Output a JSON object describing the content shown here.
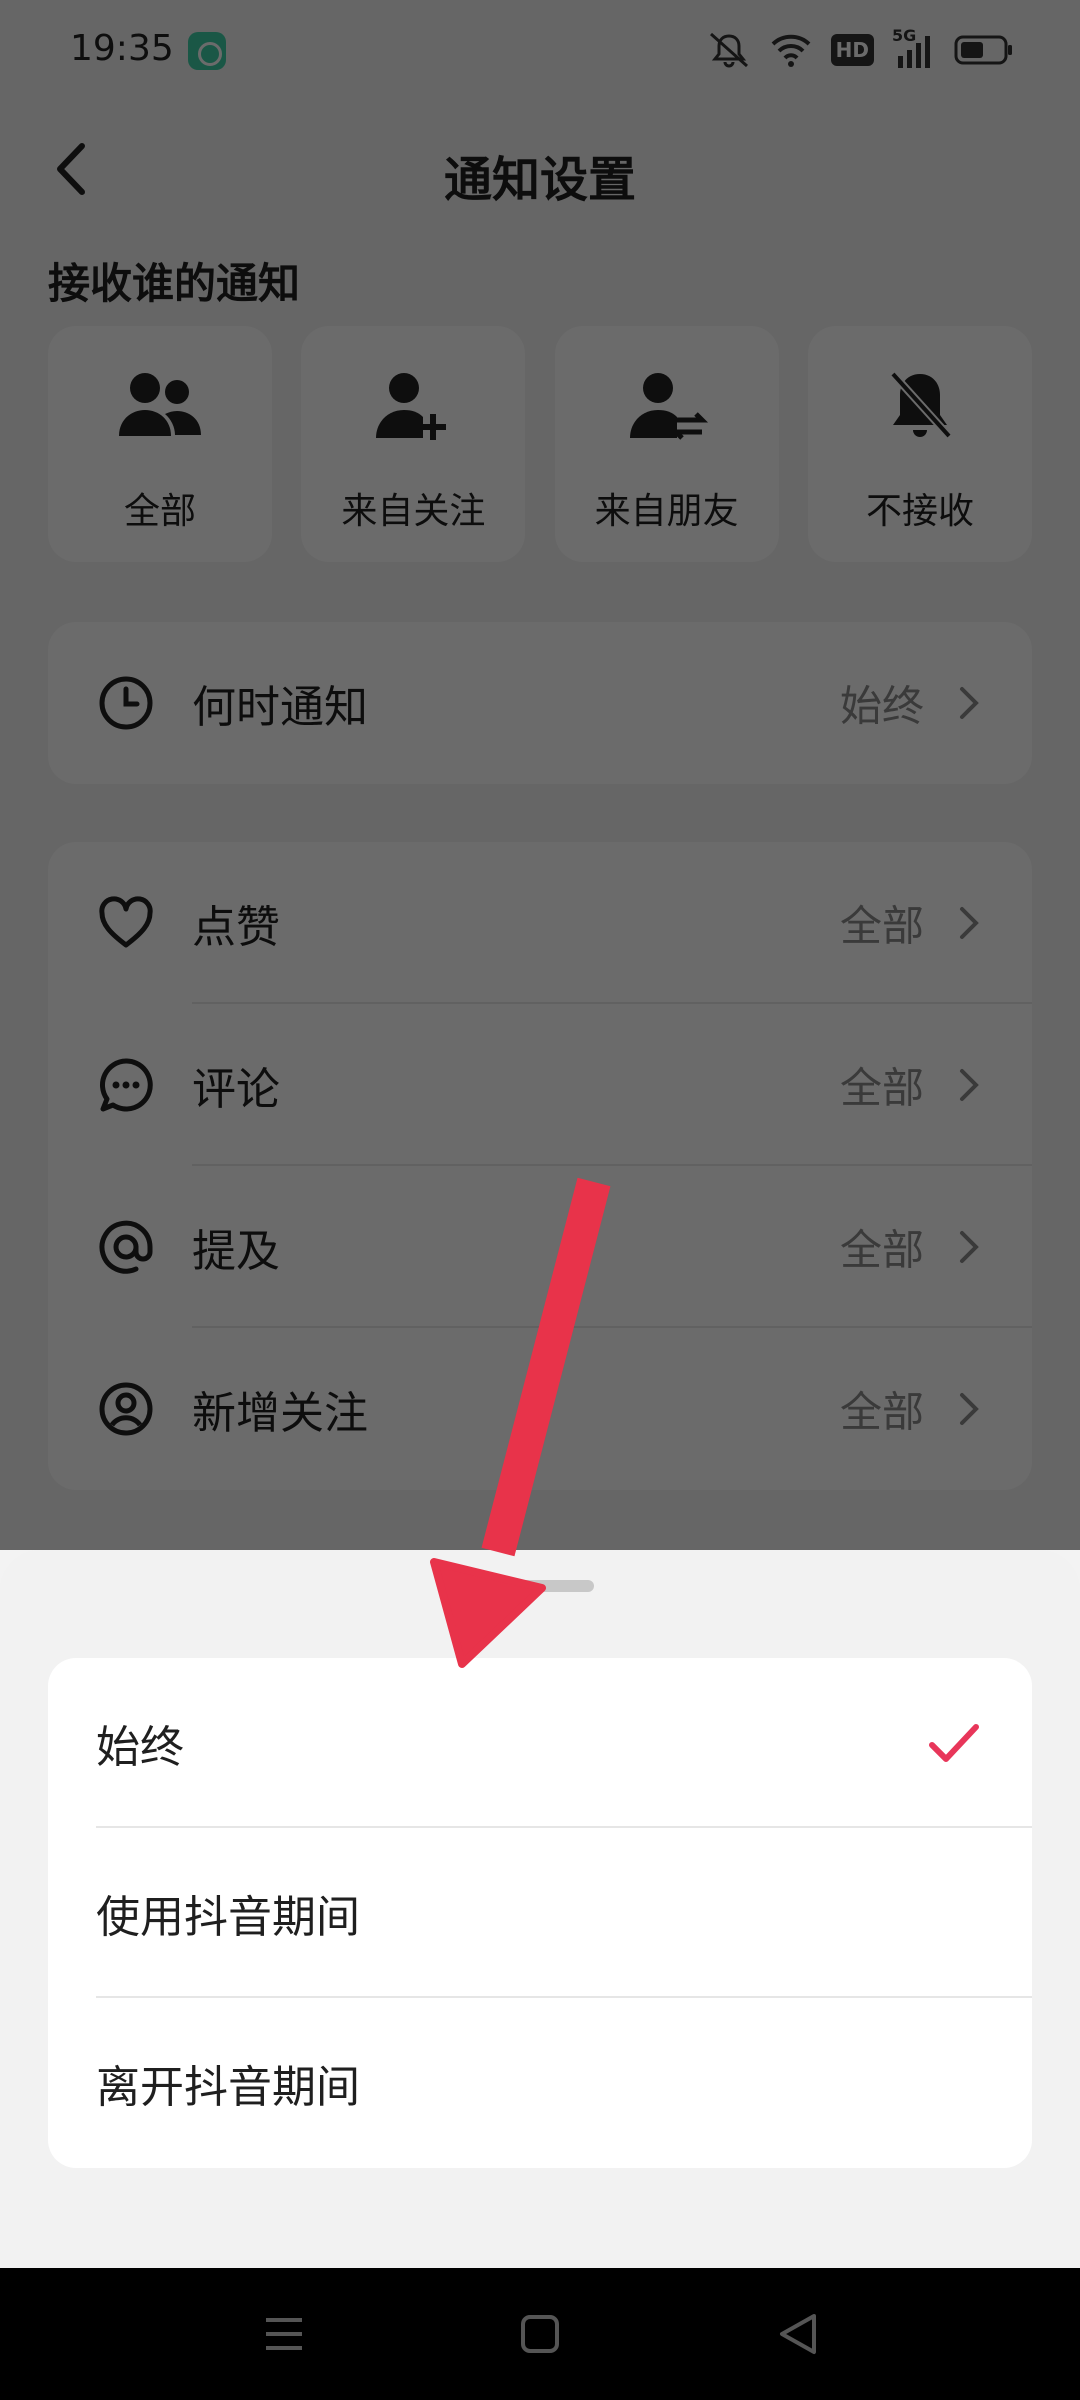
{
  "status_bar": {
    "time": "19:35",
    "icons": [
      "app-notification-icon",
      "mute-icon",
      "wifi-icon",
      "hd-icon",
      "5g-signal-icon",
      "battery-icon"
    ],
    "hd_label": "HD",
    "network_label": "5G"
  },
  "header": {
    "title": "通知设置",
    "back_icon": "chevron-left-icon"
  },
  "receive_from": {
    "label": "接收谁的通知",
    "options": [
      {
        "label": "全部",
        "icon": "users-icon"
      },
      {
        "label": "来自关注",
        "icon": "user-add-icon"
      },
      {
        "label": "来自朋友",
        "icon": "user-exchange-icon"
      },
      {
        "label": "不接收",
        "icon": "bell-off-icon"
      }
    ]
  },
  "when_notify": {
    "label": "何时通知",
    "value": "始终",
    "icon": "clock-icon"
  },
  "categories": [
    {
      "label": "点赞",
      "value": "全部",
      "icon": "heart-icon"
    },
    {
      "label": "评论",
      "value": "全部",
      "icon": "comment-icon"
    },
    {
      "label": "提及",
      "value": "全部",
      "icon": "at-icon"
    },
    {
      "label": "新增关注",
      "value": "全部",
      "icon": "user-circle-icon"
    }
  ],
  "sheet": {
    "options": [
      {
        "label": "始终",
        "selected": true
      },
      {
        "label": "使用抖音期间",
        "selected": false
      },
      {
        "label": "离开抖音期间",
        "selected": false
      }
    ]
  },
  "colors": {
    "accent": "#e8365a",
    "arrow": "#e8334a",
    "overlay": "#000000"
  }
}
